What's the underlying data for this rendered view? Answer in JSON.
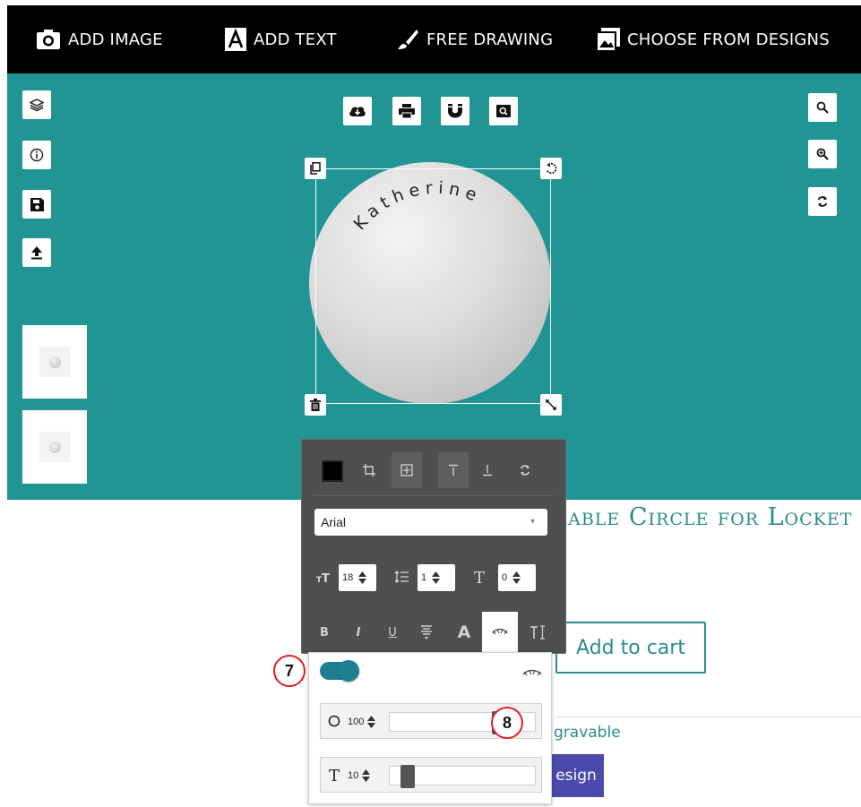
{
  "toolbar": {
    "add_image": "ADD IMAGE",
    "add_text": "ADD TEXT",
    "free_drawing": "FREE DRAWING",
    "choose_designs": "CHOOSE FROM DESIGNS"
  },
  "canvas": {
    "background_color": "#219494",
    "curved_text": "Katherine"
  },
  "product": {
    "title": "Customizable Circle for Locket",
    "price_fragment": "$",
    "add_to_cart": "Add to cart",
    "engravable_fragment": "gravable",
    "design_fragment": "esign"
  },
  "text_panel": {
    "font": "Arial",
    "font_size": "18",
    "line_height": "1",
    "letter_spacing": "0",
    "bold": "B",
    "italic": "I",
    "underline": "U",
    "font_icon": "A"
  },
  "curve_popup": {
    "toggle_on": true,
    "radius_value": "100",
    "spacing_value": "10",
    "radius_level_percent": 78,
    "spacing_level_percent": 8
  },
  "callouts": {
    "toggle": "7",
    "slider": "8"
  }
}
